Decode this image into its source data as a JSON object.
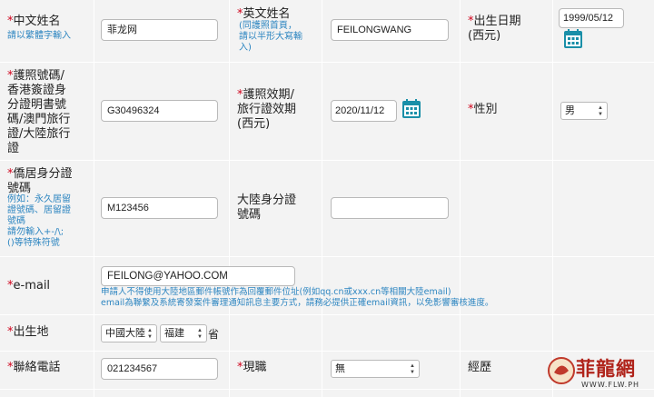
{
  "fields": {
    "chinese_name": {
      "label": "中文姓名",
      "hint": "請以繁體字輸入",
      "value": "菲龙网"
    },
    "english_name": {
      "label": "英文姓名",
      "hint_lines": [
        "(同護照首頁，",
        "請以半形大寫輸",
        "入)"
      ],
      "value": "FEILONGWANG"
    },
    "birth_date": {
      "label_lines": [
        "出生日期",
        "(西元)"
      ],
      "value": "1999/05/12"
    },
    "passport": {
      "label_lines": [
        "護照號碼/",
        "香港簽證身",
        "分證明書號",
        "碼/澳門旅行",
        "證/大陸旅行",
        "證"
      ],
      "value": "G30496324"
    },
    "passport_expiry": {
      "label_lines": [
        "護照效期/",
        "旅行證效期",
        "(西元)"
      ],
      "value": "2020/11/12"
    },
    "gender": {
      "label": "性別",
      "value": "男"
    },
    "resident_id": {
      "label_lines": [
        "僑居身分證",
        "號碼"
      ],
      "hint_lines": [
        "例如：永久居留",
        "證號碼、居留證",
        "號碼",
        "請勿輸入+-/\\;",
        "()等特殊符號"
      ],
      "value": "M123456"
    },
    "mainland_id": {
      "label_lines": [
        "大陸身分證",
        "號碼"
      ],
      "value": ""
    },
    "email": {
      "label": "e-mail",
      "value": "FEILONG@YAHOO.COM",
      "notes": [
        "申請人不得使用大陸地區郵件帳號作為回覆郵件位址(例如qq.cn或xxx.cn等相關大陸email)",
        "email為聯繫及系統寄發案件審理通知訊息主要方式，請務必提供正確email資訊，以免影響審核進度。"
      ]
    },
    "birthplace": {
      "label": "出生地",
      "country": "中國大陸",
      "province": "福建",
      "suffix": "省"
    },
    "phone": {
      "label": "聯絡電話",
      "value": "021234567"
    },
    "occupation": {
      "label": "現職",
      "value": "無"
    },
    "experience": {
      "label": "經歷"
    }
  },
  "required_mark": "*",
  "watermark": {
    "text": "菲龍網",
    "url": "WWW.FLW.PH"
  },
  "colors": {
    "required": "#d0021b",
    "hint": "#2e86c1",
    "calendar": "#1a8fa8",
    "row_bg": "#f3f3f3"
  }
}
